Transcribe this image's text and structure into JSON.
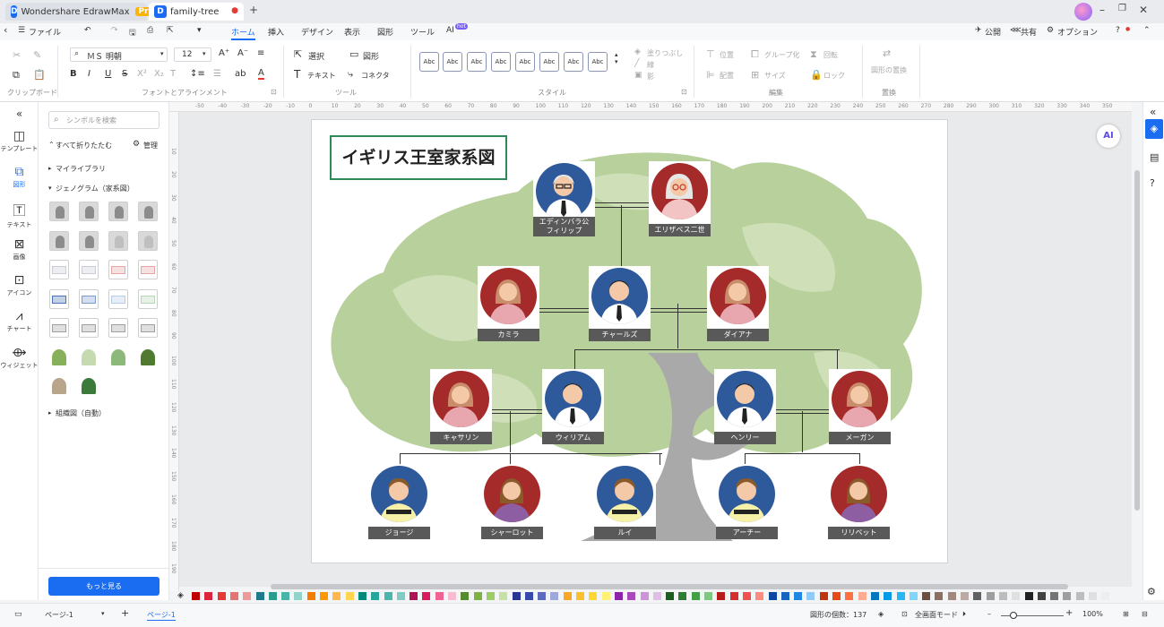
{
  "titlebar": {
    "app_tab": "Wondershare EdrawMax",
    "pro_badge": "Pro",
    "doc_tab": "family-tree",
    "new_tab": "+"
  },
  "menubar": {
    "file": "ファイル",
    "tabs": [
      "ホーム",
      "挿入",
      "デザイン",
      "表示",
      "図形",
      "ツール",
      "AI"
    ],
    "ai_badge": "hot",
    "publish": "公開",
    "share": "共有",
    "options": "オプション"
  },
  "ribbon": {
    "font_name": "ＭＳ 明朝",
    "font_size": "12",
    "group_clipboard": "クリップボード",
    "group_font": "フォントとアラインメント",
    "group_tools": "ツール",
    "group_style": "スタイル",
    "group_edit": "編集",
    "group_replace": "置換",
    "select": "選択",
    "shape": "図形",
    "text": "テキスト",
    "connector": "コネクタ",
    "fill": "塗りつぶし",
    "line": "線",
    "shadow": "影",
    "position": "位置",
    "group": "グループ化",
    "rotate": "回転",
    "align": "配置",
    "size": "サイズ",
    "lock": "ロック",
    "replace_shape": "図形の置換",
    "style_sample": "Abc"
  },
  "rail": {
    "items": [
      "テンプレート",
      "図形",
      "テキスト",
      "画像",
      "アイコン",
      "チャート",
      "ウィジェット"
    ]
  },
  "panel": {
    "search_placeholder": "シンボルを検索",
    "collapse_all": "すべて折りたたむ",
    "manage": "管理",
    "my_library": "マイライブラリ",
    "genogram": "ジェノグラム（家系図）",
    "org_chart": "組織図（自動）",
    "more": "もっと見る"
  },
  "ruler": {
    "h_ticks": [
      "-50",
      "-40",
      "-30",
      "-20",
      "-10",
      "0",
      "10",
      "20",
      "30",
      "40",
      "50",
      "60",
      "70",
      "80",
      "90",
      "100",
      "110",
      "120",
      "130",
      "140",
      "150",
      "160",
      "170",
      "180",
      "190",
      "200",
      "210",
      "220",
      "230",
      "240",
      "250",
      "260",
      "270",
      "280",
      "290",
      "300",
      "310",
      "320",
      "330",
      "340",
      "350"
    ],
    "v_ticks": [
      "10",
      "20",
      "30",
      "40",
      "50",
      "60",
      "70",
      "80",
      "90",
      "100",
      "110",
      "120",
      "130",
      "140",
      "150",
      "160",
      "170",
      "180",
      "190"
    ]
  },
  "diagram": {
    "title": "イギリス王室家系図",
    "people": {
      "philip": "エディンバラ公\nフィリップ",
      "elizabeth": "エリザベス二世",
      "camilla": "カミラ",
      "charles": "チャールズ",
      "diana": "ダイアナ",
      "catherine": "キャサリン",
      "william": "ウィリアム",
      "henry": "ヘンリー",
      "meghan": "メーガン",
      "george": "ジョージ",
      "charlotte": "シャーロット",
      "louis": "ルイ",
      "archie": "アーチー",
      "lilibet": "リリベット"
    }
  },
  "status": {
    "page_selector": "ページ-1",
    "page_tab": "ページ-1",
    "shape_count": "図形の個数：137",
    "fullscreen": "全画面モード",
    "zoom": "100%"
  },
  "colors": {
    "accent": "#1a6cf0",
    "male_circle": "#2e5a9c",
    "female_circle": "#a52a2a",
    "tree_green": "#b5cf98",
    "trunk_gray": "#a9a9a9",
    "title_border": "#2e8b57"
  }
}
